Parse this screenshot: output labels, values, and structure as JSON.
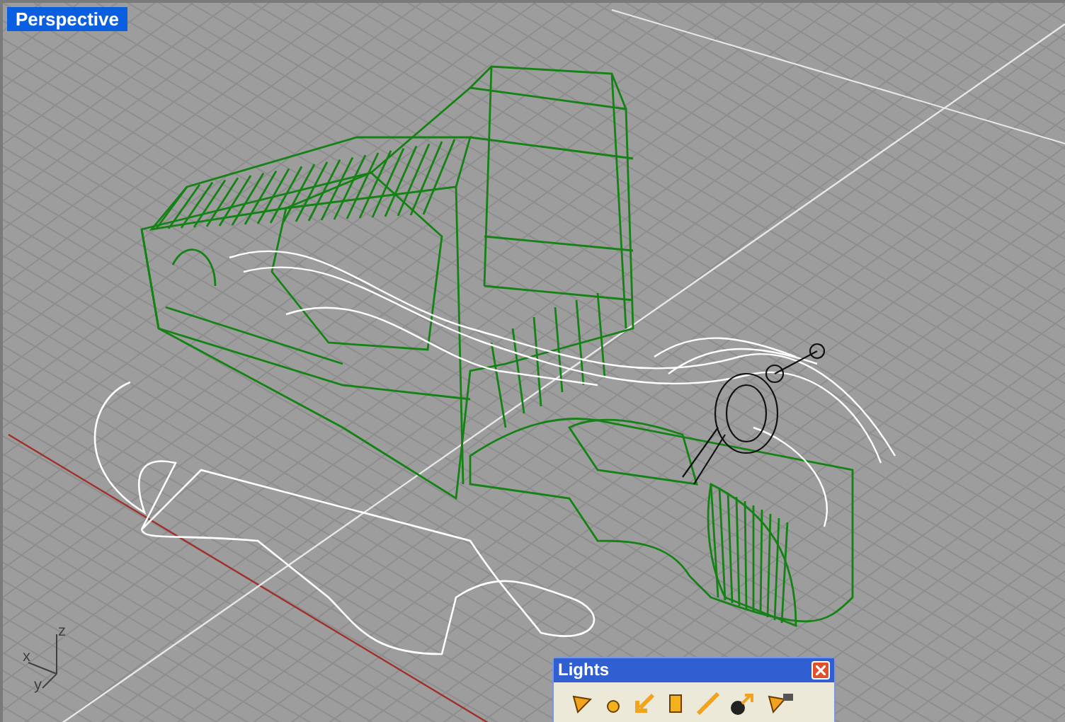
{
  "viewport": {
    "title": "Perspective",
    "axis_labels": [
      "z",
      "x",
      "y"
    ]
  },
  "lights_panel": {
    "title": "Lights"
  }
}
